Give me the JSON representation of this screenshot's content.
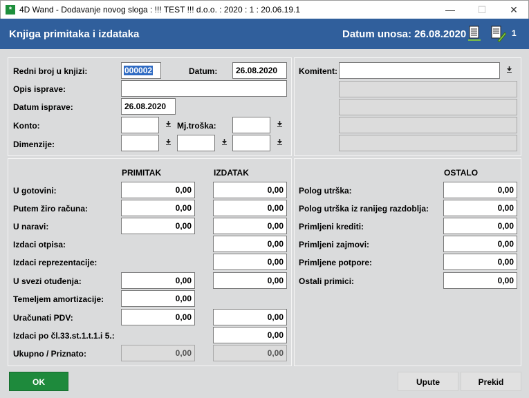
{
  "window": {
    "title": "4D Wand - Dodavanje novog sloga : !!! TEST !!! d.o.o. : 2020 : 1 : 20.06.19.1",
    "app_icon": "*",
    "minimize": "—",
    "maximize": "☐",
    "close": "✕"
  },
  "header": {
    "title": "Knjiga primitaka i izdataka",
    "date_label": "Datum unosa: 26.08.2020",
    "count": "1"
  },
  "top_left": {
    "redni_broj_label": "Redni broj u knjizi:",
    "redni_broj_value": "000002",
    "datum_label": "Datum:",
    "datum_value": "26.08.2020",
    "opis_label": "Opis isprave:",
    "opis_value": "",
    "datum_isprave_label": "Datum isprave:",
    "datum_isprave_value": "26.08.2020",
    "konto_label": "Konto:",
    "mj_troska_label": "Mj.troška:",
    "dimenzije_label": "Dimenzije:"
  },
  "top_right": {
    "komitent_label": "Komitent:",
    "komitent_value": ""
  },
  "primitak_header": "PRIMITAK",
  "izdatak_header": "IZDATAK",
  "ostalo_header": "OSTALO",
  "rows_left": [
    {
      "label": "U gotovini:",
      "primitak": "0,00",
      "izdatak": "0,00"
    },
    {
      "label": "Putem žiro računa:",
      "primitak": "0,00",
      "izdatak": "0,00"
    },
    {
      "label": "U naravi:",
      "primitak": "0,00",
      "izdatak": "0,00"
    },
    {
      "label": "Izdaci otpisa:",
      "izdatak": "0,00"
    },
    {
      "label": "Izdaci reprezentacije:",
      "izdatak": "0,00"
    },
    {
      "label": "U svezi otuđenja:",
      "primitak": "0,00",
      "izdatak": "0,00"
    },
    {
      "label": "Temeljem amortizacije:",
      "primitak": "0,00"
    },
    {
      "label": "Uračunati PDV:",
      "primitak": "0,00",
      "izdatak": "0,00"
    },
    {
      "label": "Izdaci po čl.33.st.1.t.1.i 5.:",
      "izdatak": "0,00"
    },
    {
      "label": "Ukupno / Priznato:",
      "primitak": "0,00",
      "izdatak": "0,00"
    }
  ],
  "rows_right": [
    {
      "label": "Polog utrška:",
      "value": "0,00"
    },
    {
      "label": "Polog utrška iz ranijeg razdoblja:",
      "value": "0,00"
    },
    {
      "label": "Primljeni krediti:",
      "value": "0,00"
    },
    {
      "label": "Primljeni zajmovi:",
      "value": "0,00"
    },
    {
      "label": "Primljene potpore:",
      "value": "0,00"
    },
    {
      "label": "Ostali primici:",
      "value": "0,00"
    }
  ],
  "buttons": {
    "ok": "OK",
    "upute": "Upute",
    "prekid": "Prekid"
  },
  "colors": {
    "header_bg": "#305f9c",
    "ok_bg": "#1e8a3c",
    "panel_bg": "#dadbdc"
  }
}
